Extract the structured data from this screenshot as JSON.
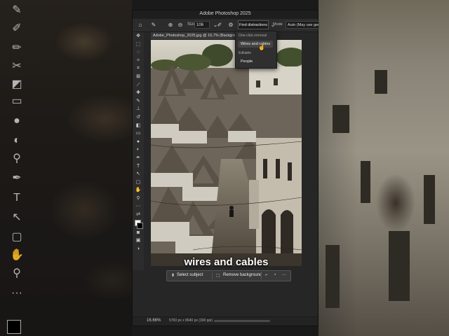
{
  "window": {
    "title": "Adobe Photoshop 2025",
    "doc_tab": "Adobe_Photoshop_2025.jpg @ 16,7% (Backgro"
  },
  "options_bar": {
    "size_label": "Size",
    "size_value": "106",
    "find_distractions_label": "Find distractions",
    "mode_label": "Mode",
    "mode_value": "Auto (May use genera"
  },
  "dropdown": {
    "section_one_click": "One-click removal",
    "option_wires": "Wires and cables",
    "section_editable": "Editable",
    "option_people": "People"
  },
  "caption": "wires and cables",
  "contextual_bar": {
    "select_subject": "Select subject",
    "remove_background": "Remove background",
    "more": "···"
  },
  "status_bar": {
    "zoom": "16.66%",
    "dimensions": "5760 px x 8640 px (300 ppi)"
  },
  "icons": {
    "home": "home-icon",
    "brush": "remove-brush-icon",
    "gear": "gear-icon"
  }
}
